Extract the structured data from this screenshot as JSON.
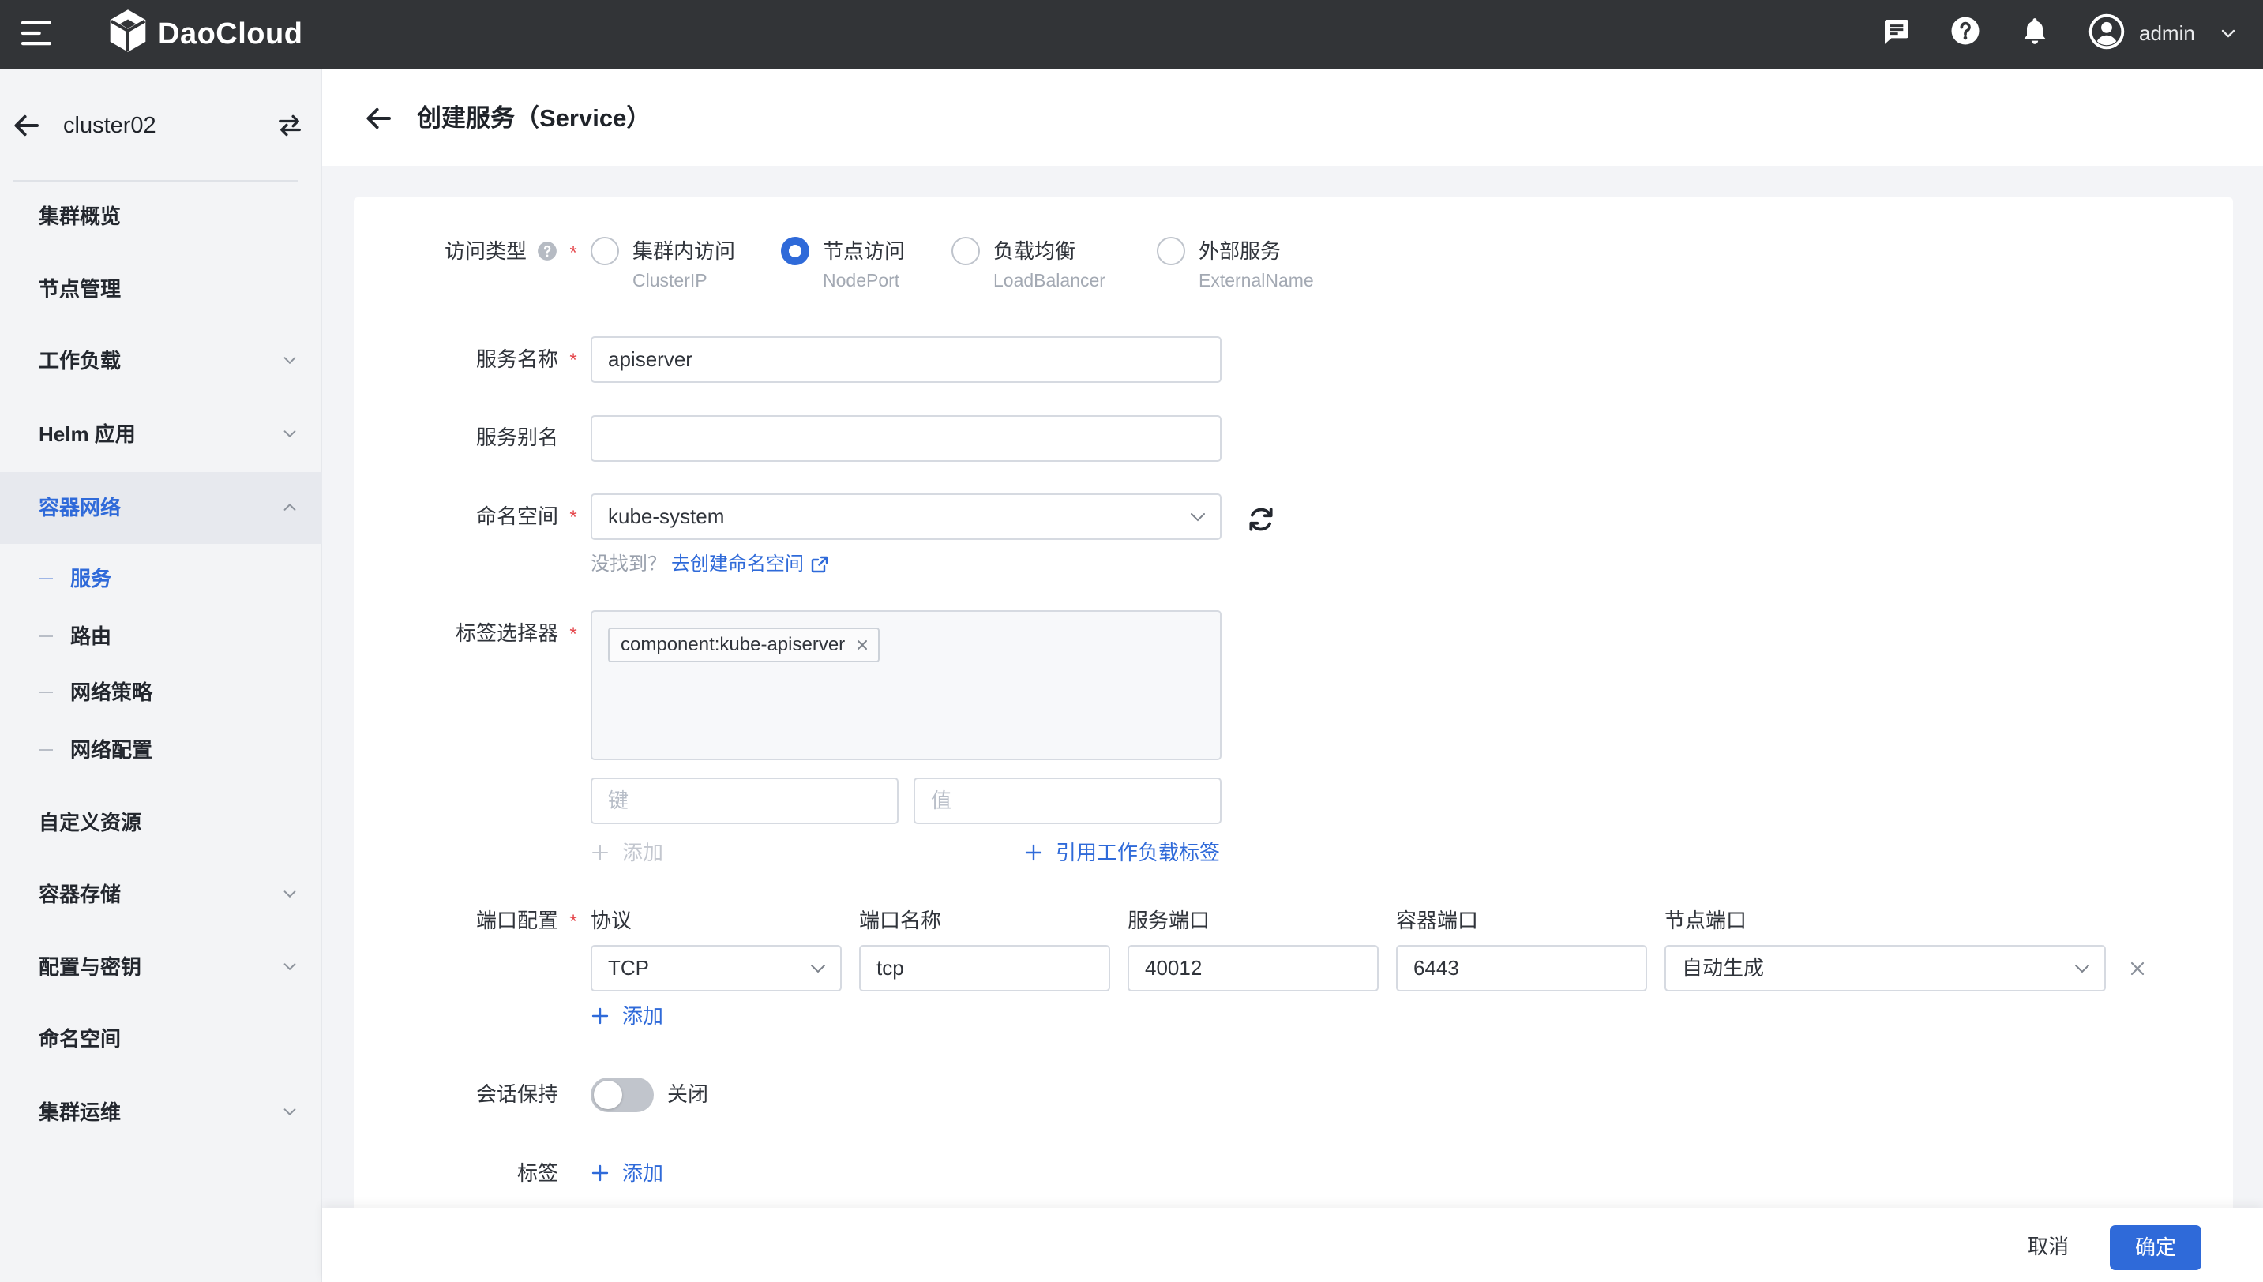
{
  "colors": {
    "primary": "#2f6ad9",
    "topbar": "#323437",
    "required": "#e5484d",
    "sidebar_bg": "#f3f4f6",
    "page_bg": "#f3f4f7"
  },
  "topbar": {
    "brand": "DaoCloud",
    "username": "admin",
    "icons": [
      "menu-icon",
      "daocloud-logo-icon",
      "message-icon",
      "help-icon",
      "bell-icon",
      "user-avatar-icon",
      "chevron-down-icon"
    ]
  },
  "sidebar": {
    "cluster_name": "cluster02",
    "items": [
      {
        "label": "集群概览"
      },
      {
        "label": "节点管理"
      },
      {
        "label": "工作负载",
        "expandable": true
      },
      {
        "label": "Helm 应用",
        "expandable": true
      },
      {
        "label": "容器网络",
        "expandable": true,
        "expanded": true,
        "active": true,
        "children": [
          {
            "label": "服务",
            "active": true
          },
          {
            "label": "路由",
            "active": false
          },
          {
            "label": "网络策略",
            "active": false
          },
          {
            "label": "网络配置",
            "active": false
          }
        ]
      },
      {
        "label": "自定义资源"
      },
      {
        "label": "容器存储",
        "expandable": true
      },
      {
        "label": "配置与密钥",
        "expandable": true
      },
      {
        "label": "命名空间"
      },
      {
        "label": "集群运维",
        "expandable": true
      }
    ]
  },
  "page": {
    "title": "创建服务（Service）"
  },
  "form": {
    "required_mark": "*",
    "access_type": {
      "label": "访问类型",
      "options": [
        {
          "label": "集群内访问",
          "value": "ClusterIP",
          "selected": false
        },
        {
          "label": "节点访问",
          "value": "NodePort",
          "selected": true
        },
        {
          "label": "负载均衡",
          "value": "LoadBalancer",
          "selected": false
        },
        {
          "label": "外部服务",
          "value": "ExternalName",
          "selected": false
        }
      ]
    },
    "service_name": {
      "label": "服务名称",
      "value": "apiserver"
    },
    "service_alias": {
      "label": "服务别名",
      "value": ""
    },
    "namespace": {
      "label": "命名空间",
      "value": "kube-system",
      "hint": "没找到？",
      "create_link": "去创建命名空间"
    },
    "label_selector": {
      "label": "标签选择器",
      "tags": [
        "component:kube-apiserver"
      ],
      "key_placeholder": "键",
      "value_placeholder": "值",
      "add": "添加",
      "reference_workload": "引用工作负载标签"
    },
    "ports": {
      "label": "端口配置",
      "columns": {
        "protocol": "协议",
        "name": "端口名称",
        "port": "服务端口",
        "target_port": "容器端口",
        "node_port": "节点端口"
      },
      "rows": [
        {
          "protocol": "TCP",
          "name": "tcp",
          "port": "40012",
          "target_port": "6443",
          "node_port": "自动生成"
        }
      ],
      "add": "添加"
    },
    "session_affinity": {
      "label": "会话保持",
      "enabled": false,
      "state_label": "关闭"
    },
    "labels": {
      "label": "标签",
      "add": "添加"
    }
  },
  "footer": {
    "cancel": "取消",
    "confirm": "确定"
  }
}
